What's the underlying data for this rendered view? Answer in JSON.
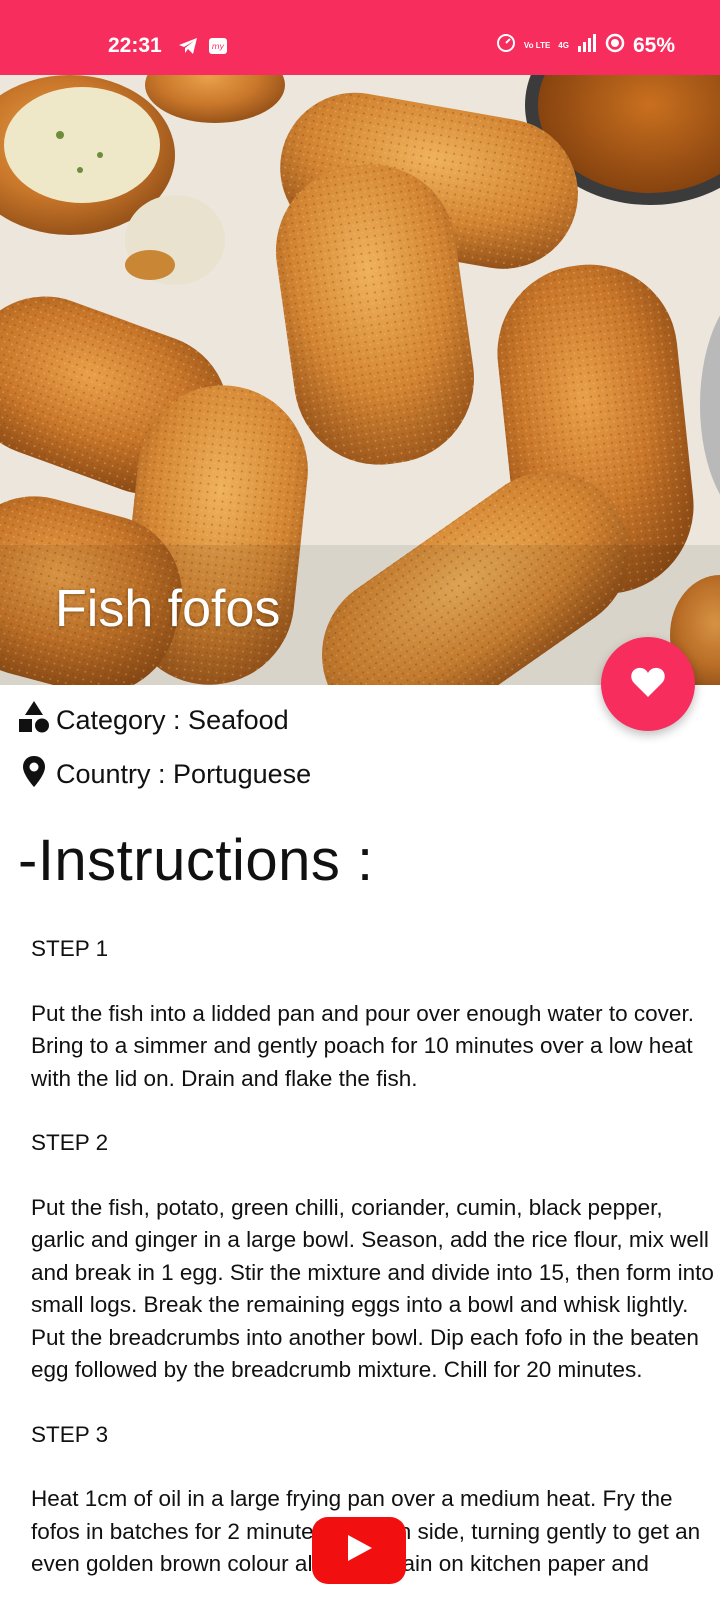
{
  "status_bar": {
    "time": "22:31",
    "battery": "65%",
    "network_label": "4G",
    "volte_label": "Vo LTE",
    "colors": {
      "background": "#f72d5e",
      "text": "#ffffff"
    },
    "icons": [
      "telegram-icon",
      "mobile-app-icon",
      "data-saver-icon",
      "volte-icon",
      "signal-icon",
      "battery-icon"
    ]
  },
  "meal": {
    "title": "Fish fofos",
    "category_label": "Category : Seafood",
    "country_label": "Country : Portuguese"
  },
  "instructions": {
    "heading": "-Instructions :",
    "steps": [
      {
        "label": "STEP 1",
        "text": "Put the fish into a lidded pan and pour over enough water to cover. Bring to a simmer and gently poach for 10 minutes over a low heat with the lid on. Drain and flake the fish."
      },
      {
        "label": "STEP 2",
        "text": "Put the fish, potato, green chilli, coriander, cumin, black pepper, garlic and ginger in a large bowl. Season, add the rice flour, mix well and break in 1 egg. Stir the mixture and divide into 15, then form into small logs. Break the remaining eggs into a bowl and whisk lightly. Put the breadcrumbs into another bowl. Dip each fofo in the beaten egg followed by the breadcrumb mixture. Chill for 20 minutes."
      },
      {
        "label": "STEP 3",
        "text": "Heat 1cm of oil in a large frying pan over a medium heat. Fry the fofos in batches for 2 minutes on each side, turning gently to get an even golden brown colour all over. Drain on kitchen paper and"
      }
    ]
  },
  "actions": {
    "favorite_icon": "heart-icon",
    "video_icon": "youtube-play-icon"
  },
  "theme": {
    "accent": "#f72d5e",
    "youtube_red": "#f20f0f"
  }
}
